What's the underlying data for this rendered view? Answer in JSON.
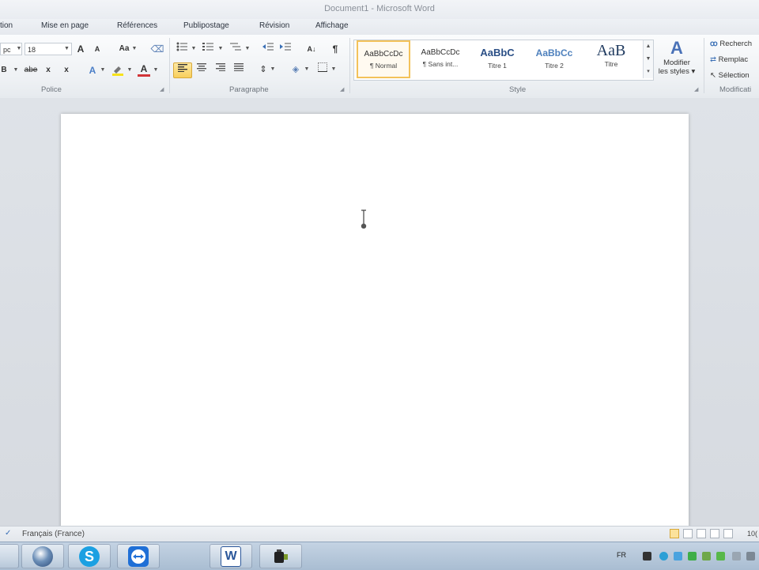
{
  "window": {
    "title": "Document1  -  Microsoft Word"
  },
  "tabs": [
    "tion",
    "Mise en page",
    "Références",
    "Publipostage",
    "Révision",
    "Affichage"
  ],
  "ribbon": {
    "font": {
      "font_name": "pc",
      "font_size": "18",
      "grow_label": "A",
      "shrink_label": "A",
      "case_label": "Aa",
      "strike_label": "abe",
      "subscript_label": "x",
      "superscript_label": "x",
      "font_color_label": "A",
      "group_label": "Police"
    },
    "paragraph": {
      "pilcrow": "¶",
      "group_label": "Paragraphe"
    },
    "styles": {
      "items": [
        {
          "sample": "AaBbCcDc",
          "name": "¶ Normal"
        },
        {
          "sample": "AaBbCcDc",
          "name": "¶ Sans int..."
        },
        {
          "sample": "AaBbC",
          "name": "Titre 1"
        },
        {
          "sample": "AaBbCc",
          "name": "Titre 2"
        },
        {
          "sample": "AaB",
          "name": "Titre"
        }
      ],
      "modify_line1": "Modifier",
      "modify_line2": "les styles",
      "modify_arrow": "▾",
      "group_label": "Style"
    },
    "editing": {
      "find": "Recherch",
      "replace": "Remplac",
      "select": "Sélection",
      "group_label": "Modificati"
    }
  },
  "statusbar": {
    "language": "Français (France)",
    "zoom": "10("
  },
  "taskbar": {
    "tray_language": "FR"
  },
  "colors": {
    "accent": "#2b579a",
    "highlight": "#f7d259",
    "font_red": "#d13438"
  }
}
